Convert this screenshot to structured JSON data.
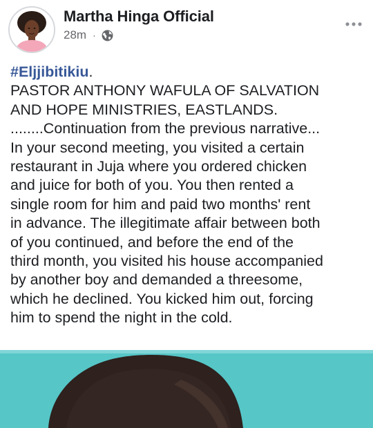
{
  "post": {
    "author": "Martha Hinga Official",
    "time": "28m",
    "separator": "·",
    "audience_icon": "globe-icon",
    "more_icon": "more-options-icon",
    "hashtag": "#Eljjibitikiu",
    "hashtag_suffix": ".",
    "lines": [
      "PASTOR ANTHONY WAFULA OF SALVATION",
      "AND HOPE MINISTRIES, EASTLANDS.",
      "........Continuation from the previous narrative...",
      "In your second meeting, you visited a certain",
      "restaurant in Juja where you ordered chicken",
      "and juice for both of you. You then rented a",
      "single room for him and paid two months' rent",
      "in advance. The illegitimate affair between both",
      "of you continued, and before the end of the",
      "third month, you visited his house accompanied",
      "by another boy and demanded a threesome,",
      "which he declined. You kicked him out, forcing",
      "him to spend the night in the cold."
    ]
  },
  "colors": {
    "text": "#1c1e21",
    "secondary": "#65676b",
    "hashtag": "#385898",
    "photo_background": "#56c6c7"
  }
}
